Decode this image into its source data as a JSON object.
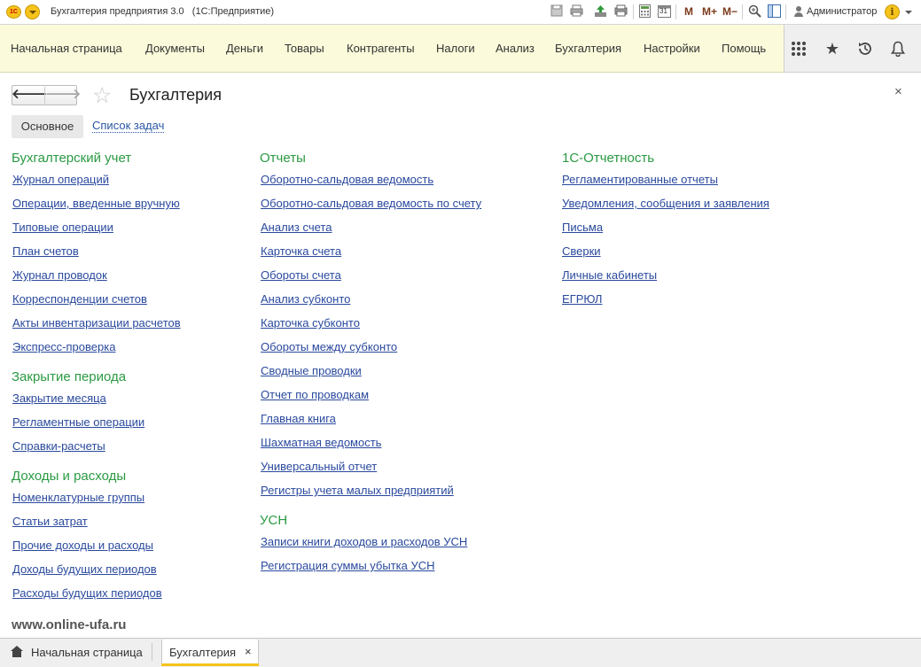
{
  "window": {
    "title": "Бухгалтерия предприятия 3.0",
    "subtitle": "(1С:Предприятие)",
    "logo_text": "1С",
    "toolbar_icons": [
      "save-icon",
      "print-icon",
      "upload-icon",
      "print-preview-icon",
      "calculator-icon",
      "calendar-icon",
      "memory-icon",
      "zoom-icon",
      "panel-icon"
    ],
    "calendar_day": "31",
    "memory": {
      "m": "M",
      "m_plus": "M+",
      "m_minus": "M−"
    },
    "user": "Администратор",
    "info_glyph": "i"
  },
  "sections": {
    "items": [
      "Начальная страница",
      "Документы",
      "Деньги",
      "Товары",
      "Контрагенты",
      "Налоги",
      "Анализ",
      "Бухгалтерия",
      "Настройки",
      "Помощь"
    ],
    "right_icons": [
      "apps-grid-icon",
      "favorites-star-icon",
      "history-icon",
      "notifications-bell-icon"
    ]
  },
  "page": {
    "title": "Бухгалтерия",
    "back_glyph": "🡐",
    "forward_glyph": "🡒",
    "close_glyph": "×",
    "tabs": {
      "main": "Основное",
      "tasks": "Список задач"
    }
  },
  "columns": {
    "col1": {
      "groups": [
        {
          "title": "Бухгалтерский учет",
          "links": [
            "Журнал операций",
            "Операции, введенные вручную",
            "Типовые операции",
            "План счетов",
            "Журнал проводок",
            "Корреспонденции счетов",
            "Акты инвентаризации расчетов",
            "Экспресс-проверка"
          ]
        },
        {
          "title": "Закрытие периода",
          "links": [
            "Закрытие месяца",
            "Регламентные операции",
            "Справки-расчеты"
          ]
        },
        {
          "title": "Доходы и расходы",
          "links": [
            "Номенклатурные группы",
            "Статьи затрат",
            "Прочие доходы и расходы",
            "Доходы будущих периодов",
            "Расходы будущих периодов"
          ]
        }
      ]
    },
    "col2": {
      "groups": [
        {
          "title": "Отчеты",
          "links": [
            "Оборотно-сальдовая ведомость",
            "Оборотно-сальдовая ведомость по счету",
            "Анализ счета",
            "Карточка счета",
            "Обороты счета",
            "Анализ субконто",
            "Карточка субконто",
            "Обороты между субконто",
            "Сводные проводки",
            "Отчет по проводкам",
            "Главная книга",
            "Шахматная ведомость",
            "Универсальный отчет",
            "Регистры учета малых предприятий"
          ]
        },
        {
          "title": "УСН",
          "links": [
            "Записи книги доходов и расходов УСН",
            "Регистрация суммы убытка УСН"
          ]
        }
      ]
    },
    "col3": {
      "groups": [
        {
          "title": "1С-Отчетность",
          "links": [
            "Регламентированные отчеты",
            "Уведомления, сообщения и заявления",
            "Письма",
            "Сверки",
            "Личные кабинеты",
            "ЕГРЮЛ"
          ]
        }
      ]
    }
  },
  "watermark": "www.online-ufa.ru",
  "taskbar": {
    "home": "Начальная страница",
    "active": "Бухгалтерия",
    "close_glyph": "×"
  },
  "colors": {
    "section_bg": "#fbfbdb",
    "group_title": "#2a9a42",
    "link": "#29499d",
    "logo": "#f5c31a"
  }
}
